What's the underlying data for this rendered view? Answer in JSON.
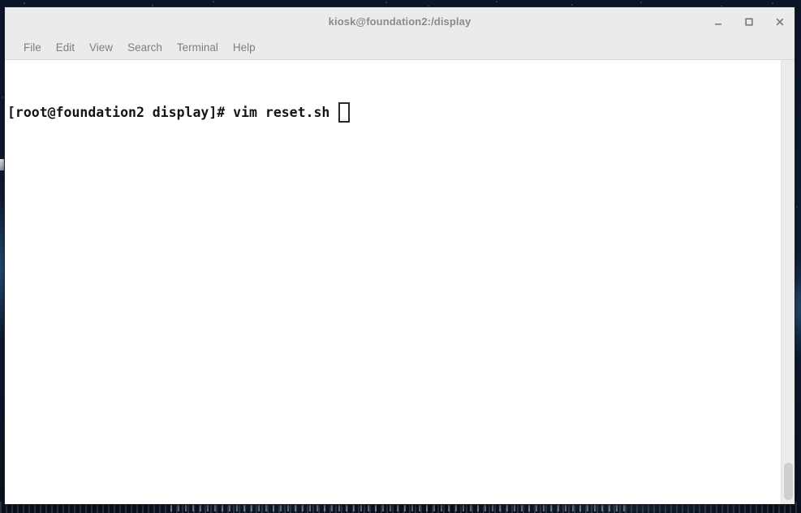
{
  "window": {
    "title": "kiosk@foundation2:/display",
    "controls": [
      {
        "name": "minimize",
        "glyph": "_",
        "label": "Minimize"
      },
      {
        "name": "maximize",
        "glyph": "□",
        "label": "Maximize"
      },
      {
        "name": "close",
        "glyph": "×",
        "label": "Close"
      }
    ]
  },
  "menubar": {
    "items": [
      {
        "label": "File"
      },
      {
        "label": "Edit"
      },
      {
        "label": "View"
      },
      {
        "label": "Search"
      },
      {
        "label": "Terminal"
      },
      {
        "label": "Help"
      }
    ]
  },
  "terminal": {
    "prompt": "[root@foundation2 display]# vim reset.sh",
    "user": "root",
    "host": "foundation2",
    "cwd": "display",
    "prompt_symbol": "#",
    "command": "vim reset.sh",
    "cursor_style": "hollow-block",
    "foreground_color": "#151515",
    "background_color": "#ffffff"
  },
  "scrollbar": {
    "position": "bottom",
    "orientation": "vertical"
  },
  "desktop": {
    "wallpaper_description": "night sky city skyline",
    "base_color": "#0d1a2e"
  }
}
